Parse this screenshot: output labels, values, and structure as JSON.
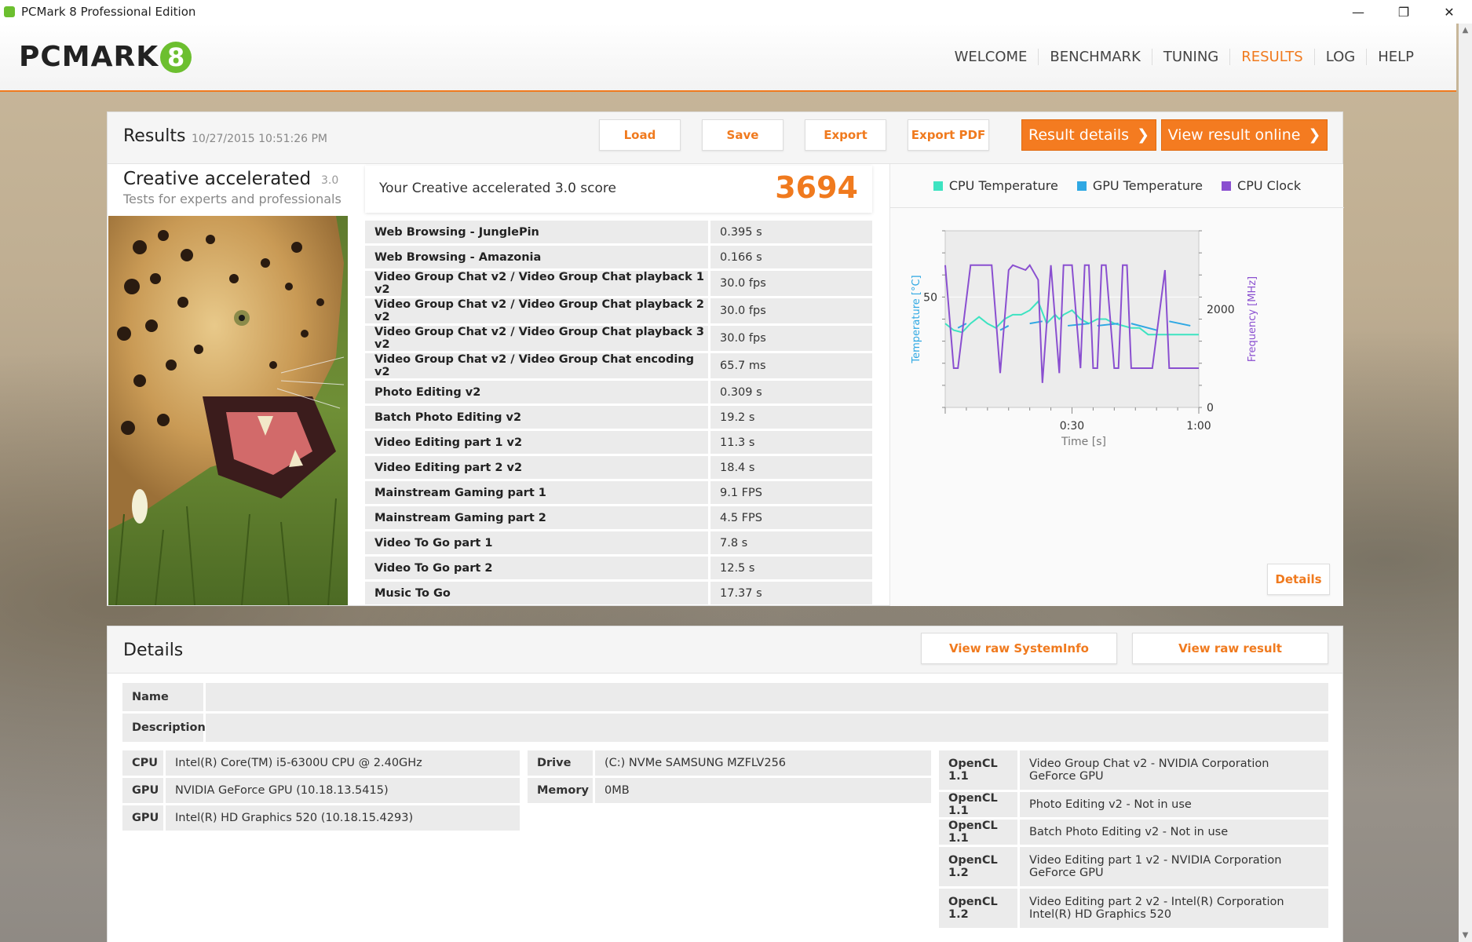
{
  "window": {
    "title": "PCMark 8 Professional Edition",
    "minimize": "—",
    "restore": "❐",
    "close": "✕"
  },
  "header": {
    "logo_text": "PCMARK",
    "logo_badge": "8",
    "nav": [
      "WELCOME",
      "BENCHMARK",
      "TUNING",
      "RESULTS",
      "LOG",
      "HELP"
    ],
    "active_nav": "RESULTS"
  },
  "results": {
    "title": "Results",
    "date": "10/27/2015 10:51:26 PM",
    "buttons": {
      "load": "Load",
      "save": "Save",
      "export": "Export",
      "export_pdf": "Export PDF",
      "result_details": "Result details",
      "view_online": "View result online"
    },
    "benchmark": {
      "name": "Creative accelerated",
      "version": "3.0",
      "subtitle": "Tests for experts and professionals"
    },
    "score_label": "Your Creative accelerated 3.0 score",
    "score": "3694",
    "rows": [
      {
        "name": "Web Browsing - JunglePin",
        "value": "0.395 s"
      },
      {
        "name": "Web Browsing - Amazonia",
        "value": "0.166 s"
      },
      {
        "name": "Video Group Chat v2 / Video Group Chat playback 1 v2",
        "value": "30.0 fps"
      },
      {
        "name": "Video Group Chat v2 / Video Group Chat playback 2 v2",
        "value": "30.0 fps"
      },
      {
        "name": "Video Group Chat v2 / Video Group Chat playback 3 v2",
        "value": "30.0 fps"
      },
      {
        "name": "Video Group Chat v2 / Video Group Chat encoding v2",
        "value": "65.7 ms"
      },
      {
        "name": "Photo Editing v2",
        "value": "0.309 s"
      },
      {
        "name": "Batch Photo Editing v2",
        "value": "19.2 s"
      },
      {
        "name": "Video Editing part 1 v2",
        "value": "11.3 s"
      },
      {
        "name": "Video Editing part 2 v2",
        "value": "18.4 s"
      },
      {
        "name": "Mainstream Gaming part 1",
        "value": "9.1 FPS"
      },
      {
        "name": "Mainstream Gaming part 2",
        "value": "4.5 FPS"
      },
      {
        "name": "Video To Go part 1",
        "value": "7.8 s"
      },
      {
        "name": "Video To Go part 2",
        "value": "12.5 s"
      },
      {
        "name": "Music To Go",
        "value": "17.37 s"
      }
    ],
    "details_button": "Details"
  },
  "chart_data": {
    "type": "line",
    "xlabel": "Time [s]",
    "ylabel_left": "Temperature [°C]",
    "ylabel_right": "Frequency [MHz]",
    "x_ticks": [
      "0:30",
      "1:00"
    ],
    "y_left_ticks": [
      "50"
    ],
    "y_right_ticks": [
      "2000",
      "0"
    ],
    "xlim": [
      0,
      60
    ],
    "ylim_left": [
      0,
      80
    ],
    "ylim_right": [
      0,
      3600
    ],
    "colors": {
      "cpu_temp": "#3de3c1",
      "gpu_temp": "#2fa8e3",
      "cpu_clock": "#8a4fd0"
    },
    "series": [
      {
        "name": "CPU Temperature",
        "axis": "left",
        "x": [
          0,
          2,
          4,
          6,
          8,
          10,
          12,
          14,
          16,
          18,
          20,
          22,
          24,
          26,
          27,
          28,
          30,
          32,
          34,
          36,
          38,
          40,
          42,
          44,
          46,
          48,
          50,
          52,
          54,
          56,
          58,
          60
        ],
        "y": [
          38,
          35,
          34,
          38,
          41,
          38,
          36,
          40,
          42,
          42,
          44,
          48,
          38,
          42,
          40,
          42,
          44,
          40,
          38,
          40,
          40,
          38,
          37,
          36,
          36,
          33,
          33,
          33,
          33,
          33,
          33,
          33
        ]
      },
      {
        "name": "GPU Temperature",
        "axis": "left",
        "x": [
          3,
          5,
          13,
          15,
          20,
          23,
          29,
          34,
          36,
          41,
          44,
          50,
          53,
          58,
          60
        ],
        "y": [
          36,
          38,
          35,
          37,
          38,
          39,
          37,
          38,
          37,
          38,
          38,
          35,
          39,
          37,
          40
        ]
      },
      {
        "name": "CPU Clock",
        "axis": "right",
        "x": [
          0,
          2,
          3,
          6,
          7,
          11,
          13,
          15,
          16,
          19,
          20,
          22,
          23,
          25,
          27,
          28,
          29,
          30,
          32,
          33,
          34,
          35,
          36,
          37,
          38,
          40,
          41,
          42,
          43,
          44,
          45,
          48,
          49,
          52,
          53,
          60
        ],
        "y": [
          2900,
          800,
          800,
          2900,
          2900,
          2900,
          700,
          2800,
          2900,
          2800,
          2900,
          2600,
          500,
          2900,
          700,
          2900,
          2900,
          2900,
          800,
          2900,
          2900,
          800,
          800,
          2900,
          2900,
          800,
          800,
          2900,
          2900,
          800,
          800,
          800,
          800,
          2800,
          800,
          800
        ]
      }
    ]
  },
  "details": {
    "title": "Details",
    "buttons": {
      "raw_sysinfo": "View raw SystemInfo",
      "raw_result": "View raw result"
    },
    "name_label": "Name",
    "description_label": "Description",
    "hardware_left": [
      {
        "key": "CPU",
        "value": "Intel(R) Core(TM) i5-6300U CPU @ 2.40GHz"
      },
      {
        "key": "GPU",
        "value": "NVIDIA GeForce GPU (10.18.13.5415)"
      },
      {
        "key": "GPU",
        "value": "Intel(R) HD Graphics 520 (10.18.15.4293)"
      }
    ],
    "hardware_mid": [
      {
        "key": "Drive",
        "value": "(C:) NVMe SAMSUNG MZFLV256"
      },
      {
        "key": "Memory",
        "value": "0MB"
      }
    ],
    "opencl": [
      {
        "key": "OpenCL 1.1",
        "value": "Video Group Chat v2 - NVIDIA Corporation GeForce GPU"
      },
      {
        "key": "OpenCL 1.1",
        "value": "Photo Editing v2 - Not in use"
      },
      {
        "key": "OpenCL 1.1",
        "value": "Batch Photo Editing v2 - Not in use"
      },
      {
        "key": "OpenCL 1.2",
        "value": "Video Editing part 1 v2 - NVIDIA Corporation GeForce GPU"
      },
      {
        "key": "OpenCL 1.2",
        "value": "Video Editing part 2 v2 - Intel(R) Corporation Intel(R) HD Graphics 520"
      }
    ]
  }
}
